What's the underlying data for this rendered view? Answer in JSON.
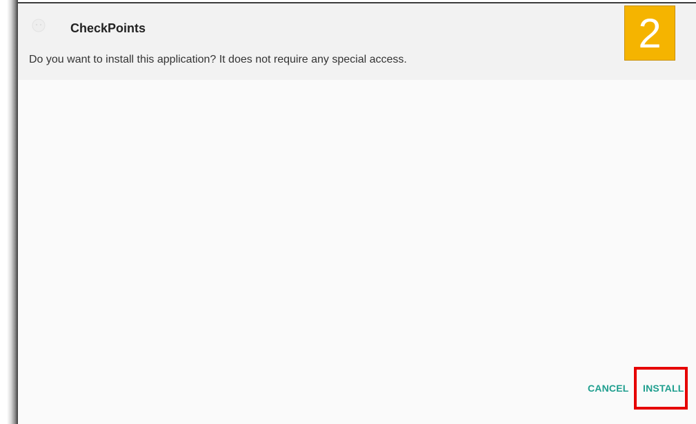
{
  "app": {
    "name": "CheckPoints",
    "icon": "app-launcher-icon"
  },
  "dialog": {
    "prompt": "Do you want to install this application? It does not require any special access."
  },
  "step_badge": {
    "number": "2",
    "color": "#f5b400"
  },
  "actions": {
    "cancel_label": "CANCEL",
    "install_label": "INSTALL",
    "accent_color": "#1e9e8e",
    "highlight_color": "#e60000"
  }
}
